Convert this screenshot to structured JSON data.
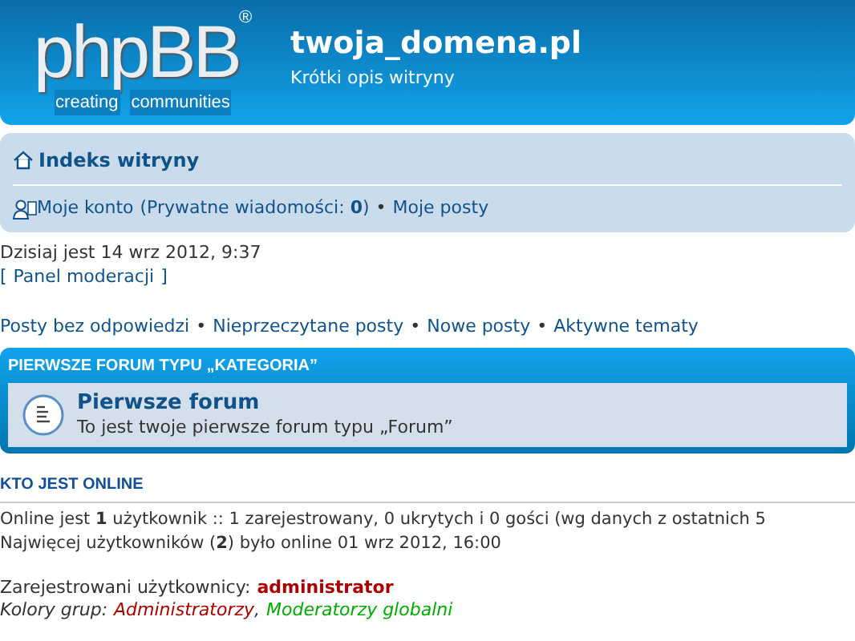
{
  "header": {
    "logo": {
      "word": "phpBB",
      "mark": "®",
      "tagline": [
        "creating",
        "communities"
      ]
    },
    "site_title": "twoja_domena.pl",
    "site_description": "Krótki opis witryny"
  },
  "navbar": {
    "index_link": "Indeks witryny",
    "account_link": "Moje konto",
    "messages": "(Prywatne wiadomości: **0**)",
    "posts_link": "Moje posty",
    "separator": "•"
  },
  "date_line": "Dzisiaj jest 14 wrz 2012, 9:37",
  "mod_panel": {
    "open": "[",
    "link": "Panel moderacji",
    "close": "]"
  },
  "quick_links": [
    {
      "label": "Posty bez odpowiedzi"
    },
    {
      "label": "Nieprzeczytane posty"
    },
    {
      "label": "Nowe posty"
    },
    {
      "label": "Aktywne tematy"
    }
  ],
  "category": {
    "title": "PIERWSZE FORUM TYPU „KATEGORIA”",
    "forums": [
      {
        "name": "Pierwsze forum",
        "description": "To jest twoje pierwsze forum typu „Forum”"
      }
    ]
  },
  "online": {
    "heading": "KTO JEST ONLINE",
    "lines": [
      "Online jest **1** użytkownik :: 1 zarejestrowany, 0 ukrytych i 0 gości (wg danych z ostatnich 5",
      "Najwięcej użytkowników (**2**) było online 01 wrz 2012, 16:00"
    ],
    "registered": {
      "label": "Zarejestrowani użytkownicy:",
      "users": [
        {
          "name": "administrator",
          "color": "#aa0000"
        }
      ]
    },
    "legend": {
      "label": "Kolory grup:",
      "separator": ",",
      "groups": [
        {
          "name": "Administratorzy",
          "color": "#aa0000"
        },
        {
          "name": "Moderatorzy globalni",
          "color": "#00aa00"
        }
      ]
    }
  }
}
